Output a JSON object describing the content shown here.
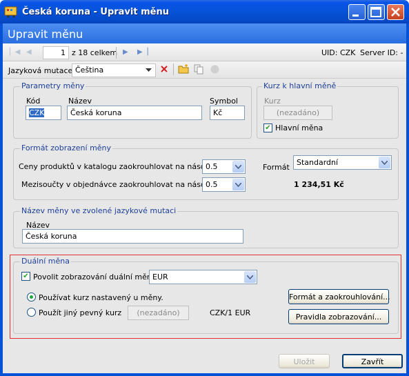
{
  "window": {
    "title": "Česká koruna - Upravit měnu"
  },
  "header": {
    "title": "Upravit měnu"
  },
  "navbar": {
    "page": "1",
    "page_of": "z 18 celkem",
    "uid": "UID: CZK",
    "server_id": "Server ID: -"
  },
  "langbar": {
    "label": "Jazyková mutace",
    "value": "Čeština"
  },
  "params": {
    "title": "Parametry měny",
    "code_label": "Kód",
    "code_value": "CZK",
    "name_label": "Název",
    "name_value": "Česká koruna",
    "symbol_label": "Symbol",
    "symbol_value": "Kč"
  },
  "rate": {
    "title": "Kurz k hlavní měně",
    "label": "Kurz",
    "value": "(nezadáno)",
    "main_currency": "Hlavní měna",
    "main_checked": true
  },
  "format": {
    "title": "Formát zobrazení měny",
    "round_catalog_label": "Ceny produktů v katalogu  zaokrouhlovat na násobky",
    "round_catalog_value": "0.5",
    "round_subtotal_label": "Mezisoučty v objednávce zaokrouhlovat na násobky",
    "round_subtotal_value": "0.5",
    "format_label": "Formát",
    "format_value": "Standardní",
    "sample": "1 234,51 Kč"
  },
  "langname": {
    "title": "Název měny ve zvolené jazykové mutaci",
    "label": "Název",
    "value": "Česká koruna"
  },
  "dual": {
    "title": "Duální měna",
    "enable_label": "Povolit zobrazování duální měny",
    "enabled": true,
    "currency": "EUR",
    "radio_currency_rate": "Používat kurz nastavený u měny.",
    "radio_fixed_rate": "Použít jiný pevný kurz",
    "fixed_rate_value": "(nezadáno)",
    "fixed_rate_unit": "CZK/1 EUR",
    "format_button": "Formát a zaokrouhlování...",
    "rules_button": "Pravidla zobrazování..."
  },
  "footer": {
    "save": "Uložit",
    "close": "Zavřít"
  },
  "colors": {
    "titlebar": "#0552d6",
    "header": "#3b80ec",
    "group_title": "#1e3f99",
    "highlight_border": "#e03030"
  }
}
